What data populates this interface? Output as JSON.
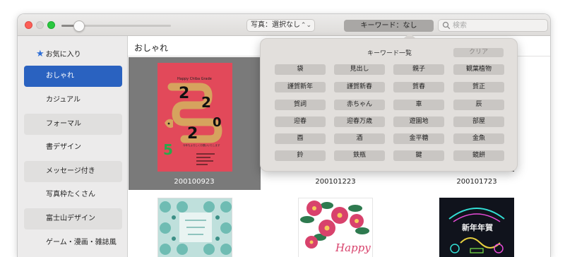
{
  "toolbar": {
    "zoom_slider_value": 0.16,
    "photo_filter": "写真：選択なし",
    "photo_filter_arrows": "⌃⌄",
    "keyword_button": "キーワード：なし",
    "search_placeholder": "検索"
  },
  "sidebar": {
    "favorites": "お気に入り",
    "items": [
      {
        "label": "おしゃれ",
        "selected": true
      },
      {
        "label": "カジュアル"
      },
      {
        "label": "フォーマル"
      },
      {
        "label": "書デザイン"
      },
      {
        "label": "メッセージ付き"
      },
      {
        "label": "写真枠たくさん"
      },
      {
        "label": "富士山デザイン"
      },
      {
        "label": "ゲーム・漫画・雑誌風"
      }
    ]
  },
  "main": {
    "title": "おしゃれ",
    "thumbnails": [
      {
        "label": "200100923"
      },
      {
        "label": "200101223"
      },
      {
        "label": "200101723"
      }
    ],
    "card1": {
      "header": "Happy Chiba Grade",
      "snake_digits": [
        "2",
        "2",
        "5",
        "2",
        "0"
      ],
      "message": "今年もよろしくお願いいたします"
    },
    "card5": {
      "text": "Happy"
    },
    "card6": {
      "text": "新年年賀"
    }
  },
  "keyword_popover": {
    "title": "キーワード一覧",
    "clear": "クリア",
    "tags": [
      "袋",
      "見出し",
      "親子",
      "観葉植物",
      "謹賀新年",
      "謹賀新春",
      "賀春",
      "賀正",
      "賀詞",
      "赤ちゃん",
      "車",
      "辰",
      "迎春",
      "迎春万歳",
      "遊園地",
      "部屋",
      "酉",
      "酒",
      "金平糖",
      "金魚",
      "鈴",
      "鉄瓶",
      "鍵",
      "鏡餅"
    ]
  },
  "colors": {
    "accent": "#2a62c0",
    "card_red": "#e2495a",
    "snake_tan": "#d6a35e"
  }
}
